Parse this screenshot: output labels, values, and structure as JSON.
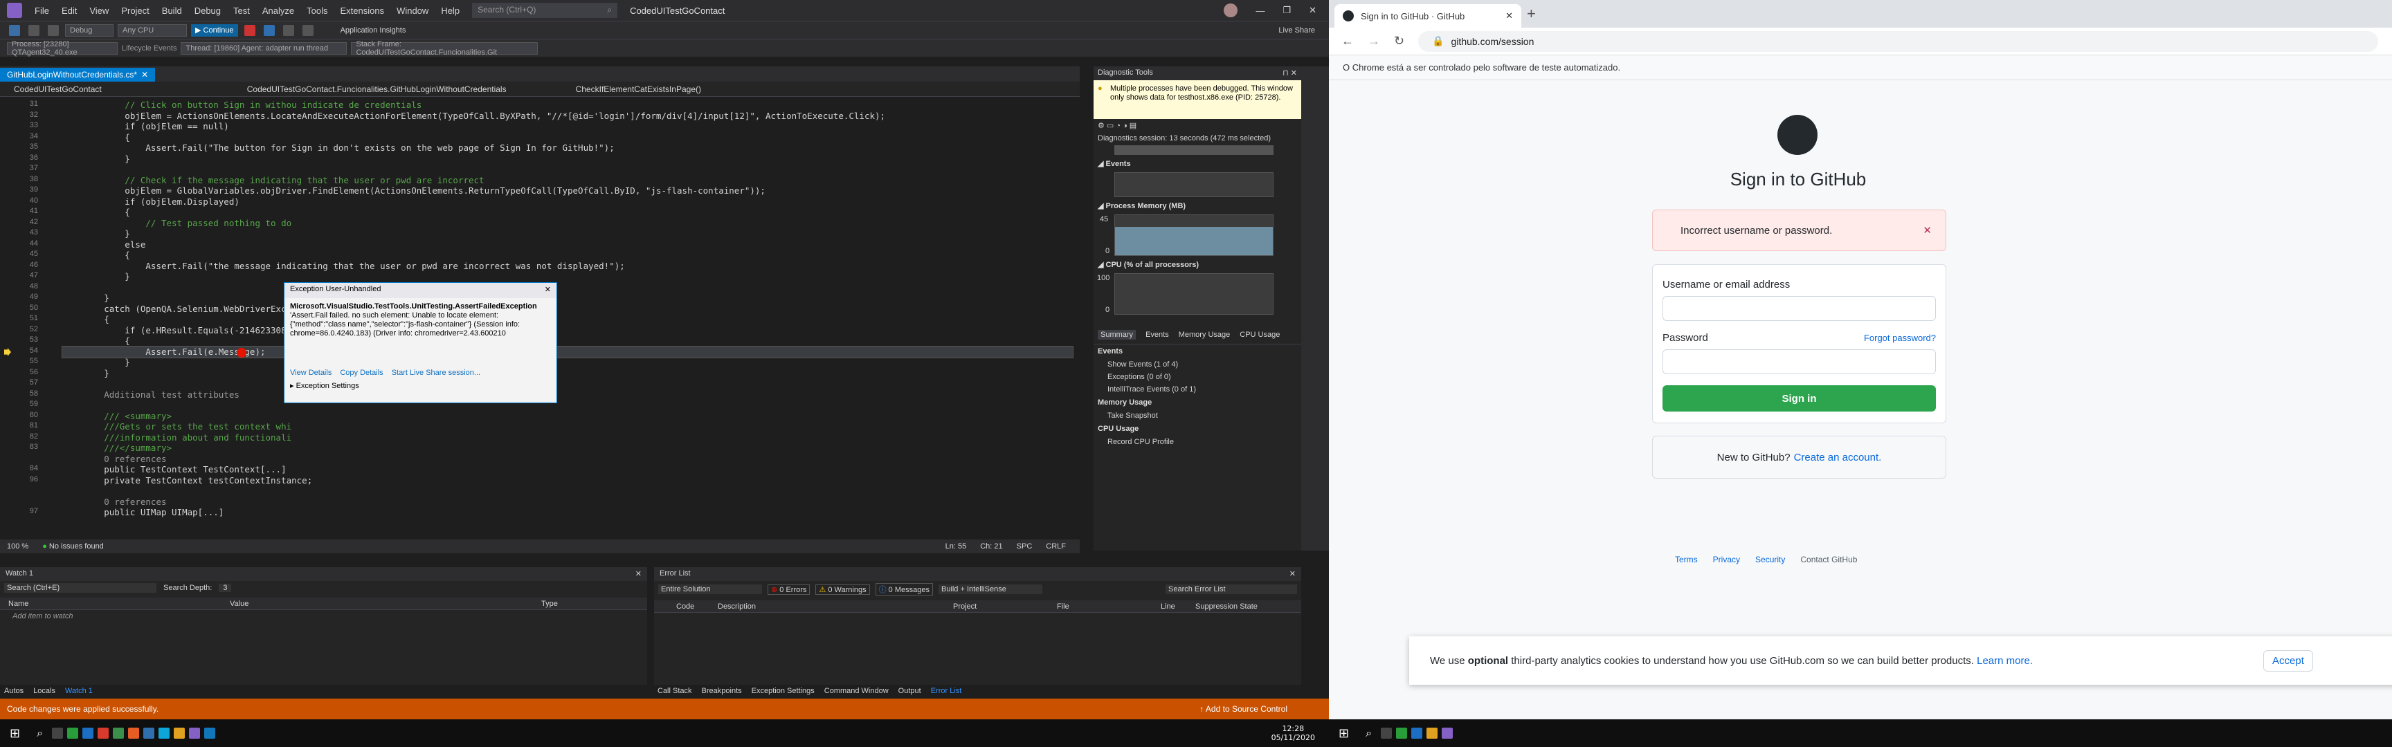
{
  "vs": {
    "menu": [
      "File",
      "Edit",
      "View",
      "Project",
      "Build",
      "Debug",
      "Test",
      "Analyze",
      "Tools",
      "Extensions",
      "Window",
      "Help"
    ],
    "search_placeholder": "Search (Ctrl+Q)",
    "project": "CodedUITestGoContact",
    "live_share": "Live Share",
    "toolbar": {
      "debug": "Debug",
      "cpu": "Any CPU",
      "continue": "Continue",
      "app_insights": "Application Insights"
    },
    "toolbar2": {
      "process": "Process: [23280] QTAgent32_40.exe",
      "lifecycle": "Lifecycle Events",
      "thread": "Thread: [19860] Agent: adapter run thread",
      "stack": "Stack Frame: CodedUITestGoContact.Funcionalities.Git"
    },
    "tab": "GitHubLoginWithoutCredentials.cs*",
    "nav": [
      "CodedUITestGoContact",
      "CodedUITestGoContact.Funcionalities.GitHubLoginWithoutCredentials",
      "CheckIfElementCatExistsInPage()"
    ],
    "code": [
      {
        "n": "31",
        "t": "            // Click on button Sign in withou indicate de credentials",
        "c": "cmt"
      },
      {
        "n": "32",
        "t": "            objElem = ActionsOnElements.LocateAndExecuteActionForElement(TypeOfCall.ByXPath, \"//*[@id='login']/form/div[4]/input[12]\", ActionToExecute.Click);",
        "c": ""
      },
      {
        "n": "33",
        "t": "            if (objElem == null)",
        "c": ""
      },
      {
        "n": "34",
        "t": "            {",
        "c": ""
      },
      {
        "n": "35",
        "t": "                Assert.Fail(\"The button for Sign in don't exists on the web page of Sign In for GitHub!\");",
        "c": ""
      },
      {
        "n": "36",
        "t": "            }",
        "c": ""
      },
      {
        "n": "37",
        "t": "",
        "c": ""
      },
      {
        "n": "38",
        "t": "            // Check if the message indicating that the user or pwd are incorrect",
        "c": "cmt"
      },
      {
        "n": "39",
        "t": "            objElem = GlobalVariables.objDriver.FindElement(ActionsOnElements.ReturnTypeOfCall(TypeOfCall.ByID, \"js-flash-container\"));",
        "c": ""
      },
      {
        "n": "40",
        "t": "            if (objElem.Displayed)",
        "c": ""
      },
      {
        "n": "41",
        "t": "            {",
        "c": ""
      },
      {
        "n": "42",
        "t": "                // Test passed nothing to do",
        "c": "cmt"
      },
      {
        "n": "43",
        "t": "            }",
        "c": ""
      },
      {
        "n": "44",
        "t": "            else",
        "c": ""
      },
      {
        "n": "45",
        "t": "            {",
        "c": ""
      },
      {
        "n": "46",
        "t": "                Assert.Fail(\"the message indicating that the user or pwd are incorrect was not displayed!\");",
        "c": ""
      },
      {
        "n": "47",
        "t": "            }",
        "c": ""
      },
      {
        "n": "48",
        "t": "",
        "c": ""
      },
      {
        "n": "49",
        "t": "        }",
        "c": ""
      },
      {
        "n": "50",
        "t": "        catch (OpenQA.Selenium.WebDriverException e)",
        "c": ""
      },
      {
        "n": "51",
        "t": "        {",
        "c": ""
      },
      {
        "n": "52",
        "t": "            if (e.HResult.Equals(-2146233088))",
        "c": ""
      },
      {
        "n": "53",
        "t": "            {",
        "c": ""
      },
      {
        "n": "54",
        "t": "                Assert.Fail(e.Message);",
        "c": "hl"
      },
      {
        "n": "55",
        "t": "            }",
        "c": ""
      },
      {
        "n": "56",
        "t": "        }",
        "c": ""
      },
      {
        "n": "57",
        "t": "",
        "c": ""
      },
      {
        "n": "58",
        "t": "        Additional test attributes",
        "c": "dim"
      },
      {
        "n": "59",
        "t": "",
        "c": ""
      },
      {
        "n": "80",
        "t": "        /// <summary>",
        "c": "cmt"
      },
      {
        "n": "81",
        "t": "        ///Gets or sets the test context whi",
        "c": "cmt"
      },
      {
        "n": "82",
        "t": "        ///information about and functionali",
        "c": "cmt"
      },
      {
        "n": "83",
        "t": "        ///</summary>",
        "c": "cmt"
      },
      {
        "n": "",
        "t": "        0 references",
        "c": "dim"
      },
      {
        "n": "84",
        "t": "        public TestContext TestContext[...]",
        "c": ""
      },
      {
        "n": "96",
        "t": "        private TestContext testContextInstance;",
        "c": ""
      },
      {
        "n": "",
        "t": "",
        "c": ""
      },
      {
        "n": "",
        "t": "        0 references",
        "c": "dim"
      },
      {
        "n": "97",
        "t": "        public UIMap UIMap[...]",
        "c": ""
      }
    ],
    "exception": {
      "title": "Exception User-Unhandled",
      "type": "Microsoft.VisualStudio.TestTools.UnitTesting.AssertFailedException",
      "message": "'Assert.Fail failed. no such element: Unable to locate element: {\"method\":\"class name\",\"selector\":\"js-flash-container\"} (Session info: chrome=86.0.4240.183) (Driver info: chromedriver=2.43.600210",
      "links": [
        "View Details",
        "Copy Details",
        "Start Live Share session..."
      ],
      "settings": "Exception Settings"
    },
    "editor_status": {
      "zoom": "100 %",
      "issues": "No issues found",
      "ln": "Ln: 55",
      "ch": "Ch: 21",
      "spc": "SPC",
      "crlf": "CRLF"
    },
    "diag": {
      "title": "Diagnostic Tools",
      "warning": "Multiple processes have been debugged. This window only shows data for testhost.x86.exe (PID: 25728).",
      "session": "Diagnostics session: 13 seconds (472 ms selected)",
      "sections": [
        "Events",
        "Process Memory (MB)",
        "CPU (% of all processors)"
      ],
      "mem_max": "45",
      "mem_min": "0",
      "cpu_max": "100",
      "cpu_min": "0",
      "tabs": [
        "Summary",
        "Events",
        "Memory Usage",
        "CPU Usage"
      ],
      "events_h": "Events",
      "events": [
        "Show Events (1 of 4)",
        "Exceptions (0 of 0)",
        "IntelliTrace Events (0 of 1)"
      ],
      "mem_h": "Memory Usage",
      "snapshot": "Take Snapshot",
      "cpu_h": "CPU Usage",
      "cpu_prof": "Record CPU Profile"
    },
    "watch": {
      "title": "Watch 1",
      "search": "Search (Ctrl+E)",
      "depth": "Search Depth:",
      "depth_val": "3",
      "cols": [
        "Name",
        "Value",
        "Type"
      ],
      "add": "Add item to watch"
    },
    "watch_tabs": [
      "Autos",
      "Locals",
      "Watch 1"
    ],
    "errlist": {
      "title": "Error List",
      "scope": "Entire Solution",
      "errors": "0 Errors",
      "warnings": "0 Warnings",
      "messages": "0 Messages",
      "build": "Build + IntelliSense",
      "search": "Search Error List",
      "cols": [
        "Code",
        "Description",
        "Project",
        "File",
        "Line",
        "Suppression State"
      ]
    },
    "err_tabs": [
      "Call Stack",
      "Breakpoints",
      "Exception Settings",
      "Command Window",
      "Output",
      "Error List"
    ],
    "status": {
      "msg": "Code changes were applied successfully.",
      "source": "Add to Source Control"
    }
  },
  "chrome": {
    "tab_title": "Sign in to GitHub · GitHub",
    "url": "github.com/session",
    "info": "O Chrome está a ser controlado pelo software de teste automatizado."
  },
  "github": {
    "heading": "Sign in to GitHub",
    "error": "Incorrect username or password.",
    "username_label": "Username or email address",
    "password_label": "Password",
    "forgot": "Forgot password?",
    "signin": "Sign in",
    "new_prompt": "New to GitHub?",
    "create": "Create an account.",
    "footer": [
      "Terms",
      "Privacy",
      "Security",
      "Contact GitHub"
    ],
    "cookie_pre": "We use",
    "cookie_bold": "optional",
    "cookie_post": "third-party analytics cookies to understand how you use GitHub.com so we can build better products.",
    "cookie_link": "Learn more.",
    "accept": "Accept"
  },
  "taskbar": {
    "time_left": "12:28",
    "date_left": "05/11/2020"
  },
  "colors": {
    "vs_accent": "#007acc",
    "status": "#ca5100",
    "gh_green": "#2da44e",
    "gh_link": "#0969da"
  }
}
